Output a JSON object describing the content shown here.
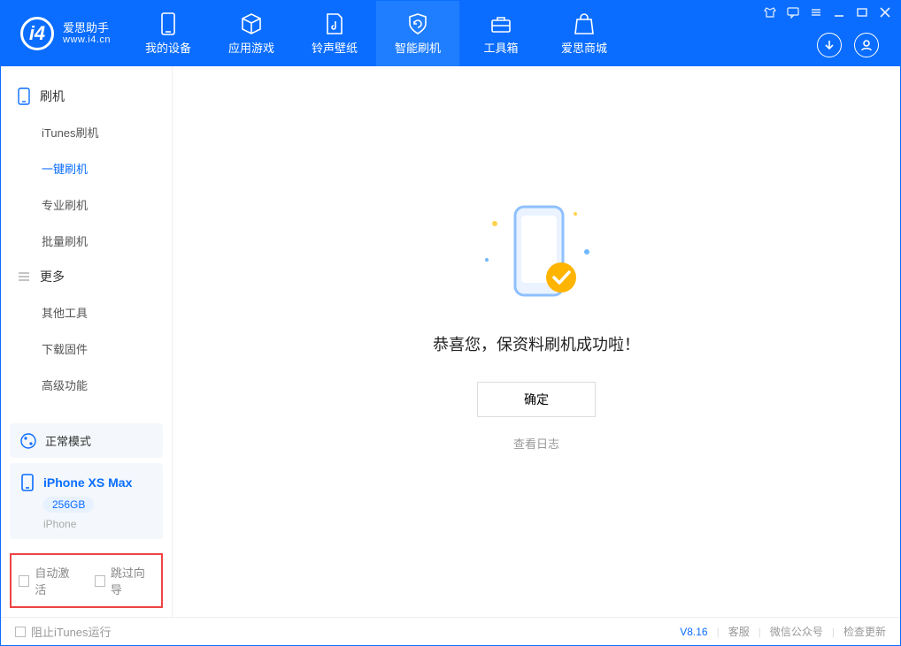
{
  "brand": {
    "name": "爱思助手",
    "url": "www.i4.cn"
  },
  "header_tabs": {
    "device": "我的设备",
    "apps": "应用游戏",
    "ring": "铃声壁纸",
    "flash": "智能刷机",
    "tools": "工具箱",
    "store": "爱思商城"
  },
  "sidebar": {
    "section_flash": "刷机",
    "items_flash": {
      "itunes": "iTunes刷机",
      "onekey": "一键刷机",
      "pro": "专业刷机",
      "batch": "批量刷机"
    },
    "section_more": "更多",
    "items_more": {
      "other": "其他工具",
      "firmware": "下载固件",
      "adv": "高级功能"
    }
  },
  "mode_bar": {
    "label": "正常模式"
  },
  "device": {
    "name": "iPhone XS Max",
    "storage": "256GB",
    "type": "iPhone"
  },
  "options": {
    "auto_activate": "自动激活",
    "skip_wizard": "跳过向导"
  },
  "main": {
    "message": "恭喜您，保资料刷机成功啦！",
    "ok": "确定",
    "view_log": "查看日志"
  },
  "footer": {
    "block_itunes": "阻止iTunes运行",
    "version": "V8.16",
    "cs": "客服",
    "wechat": "微信公众号",
    "update": "检查更新"
  }
}
